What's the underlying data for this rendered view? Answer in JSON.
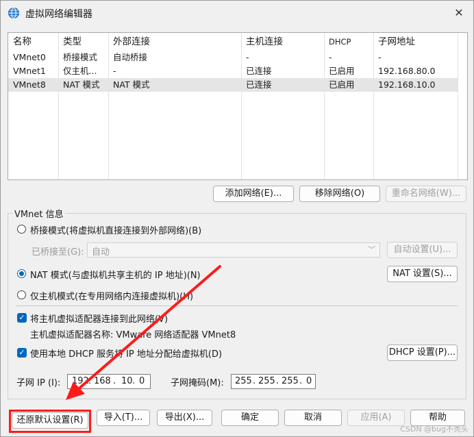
{
  "window": {
    "title": "虚拟网络编辑器",
    "close_label": "✕"
  },
  "table": {
    "headers": [
      "名称",
      "类型",
      "外部连接",
      "主机连接",
      "DHCP",
      "子网地址"
    ],
    "rows": [
      [
        "VMnet0",
        "桥接模式",
        "自动桥接",
        "-",
        "-",
        "-"
      ],
      [
        "VMnet1",
        "仅主机...",
        "-",
        "已连接",
        "已启用",
        "192.168.80.0"
      ],
      [
        "VMnet8",
        "NAT 模式",
        "NAT 模式",
        "已连接",
        "已启用",
        "192.168.10.0"
      ]
    ],
    "selected_row": 2
  },
  "list_buttons": {
    "add": "添加网络(E)...",
    "remove": "移除网络(O)",
    "rename": "重命名网络(W)..."
  },
  "vmnet_info": {
    "label": "VMnet 信息",
    "bridge_label": "桥接模式(将虚拟机直接连接到外部网络)(B)",
    "bridged_to_label": "已桥接至(G):",
    "bridged_to_value": "自动",
    "auto_settings": "自动设置(U)...",
    "nat_label": "NAT 模式(与虚拟机共享主机的 IP 地址)(N)",
    "nat_settings": "NAT 设置(S)...",
    "host_only_label": "仅主机模式(在专用网络内连接虚拟机)(H)",
    "connect_adapter_label": "将主机虚拟适配器连接到此网络(V)",
    "adapter_name_label": "主机虚拟适配器名称: VMware 网络适配器 VMnet8",
    "dhcp_label": "使用本地 DHCP 服务将 IP 地址分配给虚拟机(D)",
    "dhcp_settings": "DHCP 设置(P)...",
    "subnet_ip_label": "子网 IP (I):",
    "subnet_ip": [
      "192",
      "168",
      "10",
      "0"
    ],
    "subnet_mask_label": "子网掩码(M):",
    "subnet_mask": [
      "255",
      "255",
      "255",
      "0"
    ],
    "selected_mode": "nat",
    "connect_adapter_checked": true,
    "dhcp_checked": true
  },
  "footer": {
    "restore": "还原默认设置(R)",
    "import": "导入(T)...",
    "export": "导出(X)...",
    "ok": "确定",
    "cancel": "取消",
    "apply": "应用(A)",
    "help": "帮助"
  },
  "watermark": "CSDN @bug不秃头",
  "colors": {
    "accent": "#0067c0",
    "annotation": "#ff1a1a"
  }
}
